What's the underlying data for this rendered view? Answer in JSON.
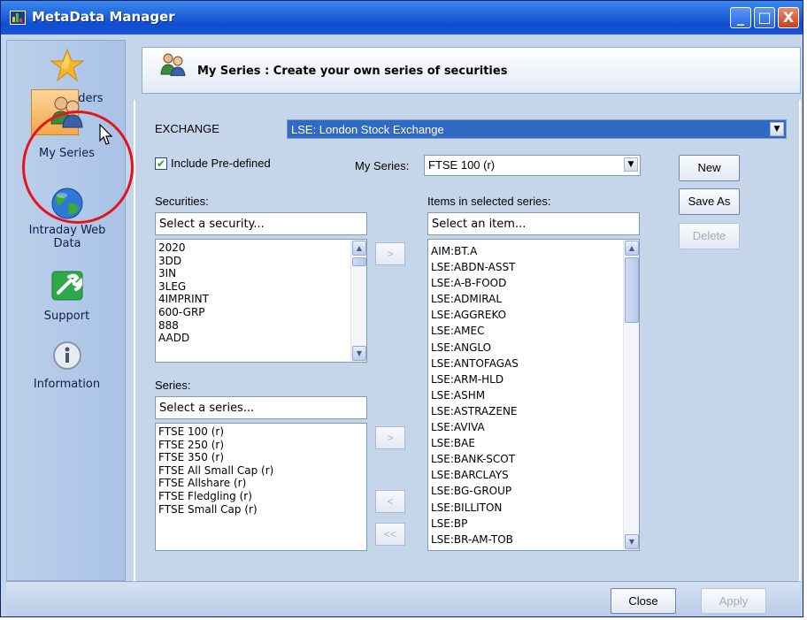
{
  "window": {
    "title": "MetaData Manager",
    "controls": {
      "minimize": "_",
      "maximize": "□",
      "close": "X"
    }
  },
  "sidebar": {
    "items": [
      {
        "label": "Data Folders",
        "icon": "star-icon"
      },
      {
        "label": "My Series",
        "icon": "people-icon",
        "selected": true
      },
      {
        "label": "Intraday Web Data",
        "icon": "globe-icon"
      },
      {
        "label": "Support",
        "icon": "wrench-icon"
      },
      {
        "label": "Information",
        "icon": "info-icon"
      }
    ]
  },
  "header": {
    "title": "My Series : Create your own series of securities"
  },
  "form": {
    "exchange_label": "EXCHANGE",
    "exchange_value": "LSE: London Stock Exchange",
    "include_predefined_label": "Include Pre-defined",
    "include_predefined_checked": true,
    "my_series_label": "My Series:",
    "my_series_value": "FTSE 100 (r)",
    "securities_label": "Securities:",
    "securities_placeholder": "Select a security...",
    "securities": [
      "2020",
      "3DD",
      "3IN",
      "3LEG",
      "4IMPRINT",
      "600-GRP",
      "888",
      "AADD"
    ],
    "series_label": "Series:",
    "series_placeholder": "Select a series...",
    "series": [
      "FTSE 100 (r)",
      "FTSE 250 (r)",
      "FTSE 350 (r)",
      "FTSE All Small Cap (r)",
      "FTSE Allshare (r)",
      "FTSE Fledgling (r)",
      "FTSE Small Cap (r)"
    ],
    "items_label": "Items in selected series:",
    "items_placeholder": "Select an item...",
    "items": [
      "AIM:BT.A",
      "LSE:ABDN-ASST",
      "LSE:A-B-FOOD",
      "LSE:ADMIRAL",
      "LSE:AGGREKO",
      "LSE:AMEC",
      "LSE:ANGLO",
      "LSE:ANTOFAGAS",
      "LSE:ARM-HLD",
      "LSE:ASHM",
      "LSE:ASTRAZENE",
      "LSE:AVIVA",
      "LSE:BAE",
      "LSE:BANK-SCOT",
      "LSE:BARCLAYS",
      "LSE:BG-GROUP",
      "LSE:BILLITON",
      "LSE:BP",
      "LSE:BR-AM-TOB"
    ]
  },
  "buttons": {
    "new": "New",
    "save_as": "Save As",
    "delete": "Delete",
    "add_security": ">",
    "add_series": ">",
    "remove_item": "<",
    "remove_all": "<<",
    "close": "Close",
    "apply": "Apply"
  },
  "colors": {
    "titlebar": "#2466dc",
    "selection": "#316ac5",
    "annotation_circle": "#e3151c"
  }
}
